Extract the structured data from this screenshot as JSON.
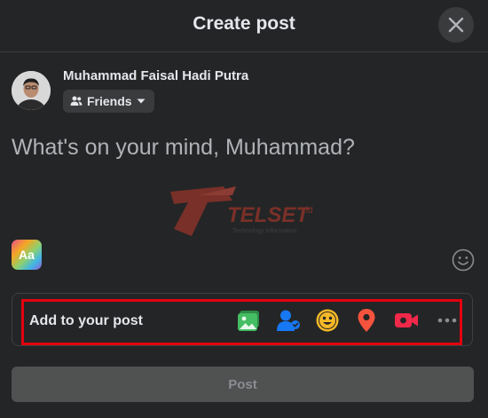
{
  "header": {
    "title": "Create post"
  },
  "user": {
    "name": "Muhammad Faisal Hadi Putra",
    "audience": "Friends"
  },
  "composer": {
    "placeholder": "What's on your mind, Muhammad?"
  },
  "watermark": {
    "brand": "TELSET",
    "suffix": ".id",
    "tagline": "Technology Information"
  },
  "text_format": {
    "label": "Aa"
  },
  "add_to_post": {
    "label": "Add to your post",
    "tools": [
      "photo-video",
      "tag-people",
      "feeling-activity",
      "check-in",
      "live-video",
      "more"
    ]
  },
  "footer": {
    "post_label": "Post"
  },
  "colors": {
    "background": "#242526",
    "surface": "#3a3b3c",
    "photo": "#45bd62",
    "tag": "#1877f2",
    "feeling": "#f7b928",
    "checkin": "#f5533d",
    "live": "#f02849",
    "highlight": "#e3000f"
  }
}
